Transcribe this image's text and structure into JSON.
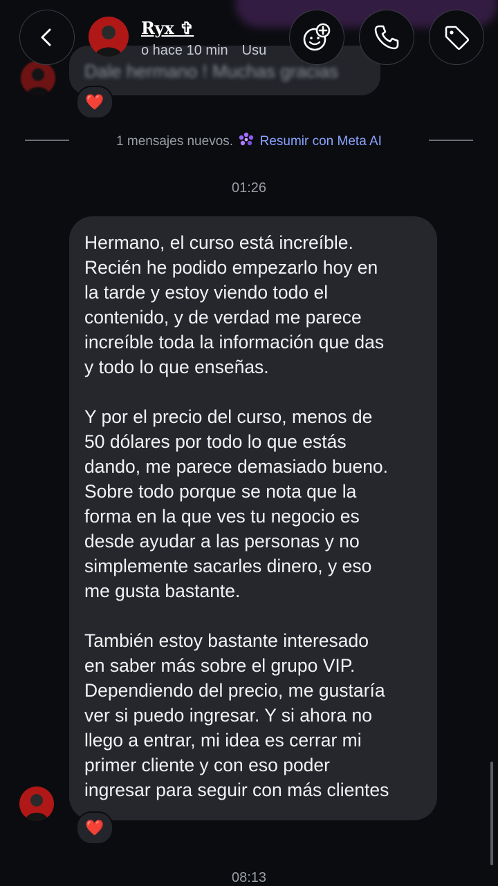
{
  "header": {
    "contact_name": "Ryx ✞",
    "status_text": "o hace 10 min",
    "status_extra": "Usu",
    "back_icon": "chevron-left-icon",
    "effects_icon": "sticker-add-icon",
    "call_icon": "phone-icon",
    "tag_icon": "tag-icon"
  },
  "previous_message": {
    "text": "Dale hermano ! Muchas gracias",
    "reaction": "❤️"
  },
  "new_messages_divider": {
    "count_text": "1 mensajes nuevos.",
    "meta_ai_icon": "meta-ai-icon",
    "summarize_label": "Resumir con Meta AI"
  },
  "timestamps": {
    "first": "01:26",
    "second": "08:13"
  },
  "message": {
    "paragraphs": [
      "Hermano, el curso está increíble.\nRecién he podido empezarlo hoy en\nla tarde y estoy viendo todo el\ncontenido, y de verdad me parece\nincreíble toda la información que das\ny todo lo que enseñas.",
      "Y por el precio del curso, menos de\n50 dólares por todo lo que estás\ndando, me parece demasiado bueno.\nSobre todo porque se nota que la\nforma en la que ves tu negocio es\ndesde ayudar a las personas y no\nsimplemente sacarles dinero, y eso\nme gusta bastante.",
      "También estoy bastante interesado\nen saber más sobre el grupo VIP.\nDependiendo del precio, me gustaría\nver si puedo ingresar. Y si ahora no\nllego a entrar, mi idea es cerrar mi\nprimer cliente y con eso poder\ningresar para seguir con más clientes"
    ],
    "reaction": "❤️"
  },
  "colors": {
    "background": "#0b0c10",
    "bubble": "#26272c",
    "meta_link": "#8aa3ff",
    "avatar_red": "#b01818"
  }
}
